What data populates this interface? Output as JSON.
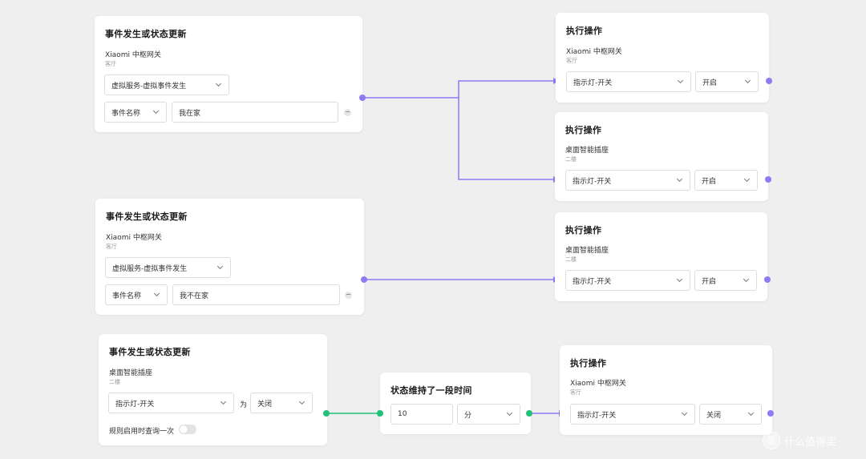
{
  "trigger_1": {
    "title": "事件发生或状态更新",
    "device": "Xiaomi 中枢网关",
    "room": "客厅",
    "event_select": "虚拟服务-虚拟事件发生",
    "param_select": "事件名称",
    "param_value": "我在家",
    "remove_symbol": "−"
  },
  "action_1": {
    "title": "执行操作",
    "device": "Xiaomi 中枢网关",
    "room": "客厅",
    "property_select": "指示灯-开关",
    "value_select": "开启"
  },
  "action_2": {
    "title": "执行操作",
    "device": "桌面智能插座",
    "room": "二楼",
    "property_select": "指示灯-开关",
    "value_select": "开启"
  },
  "trigger_2": {
    "title": "事件发生或状态更新",
    "device": "Xiaomi 中枢网关",
    "room": "客厅",
    "event_select": "虚拟服务-虚拟事件发生",
    "param_select": "事件名称",
    "param_value": "我不在家",
    "remove_symbol": "−"
  },
  "action_3": {
    "title": "执行操作",
    "device": "桌面智能插座",
    "room": "二楼",
    "property_select": "指示灯-开关",
    "value_select": "开启"
  },
  "trigger_3": {
    "title": "事件发生或状态更新",
    "device": "桌面智能插座",
    "room": "二楼",
    "property_select": "指示灯-开关",
    "is_label": "为",
    "value_select": "关闭",
    "query_label": "规则启用时查询一次",
    "query_toggle_on": false
  },
  "condition_1": {
    "title": "状态维持了一段时间",
    "duration_value": "10",
    "unit_select": "分"
  },
  "action_4": {
    "title": "执行操作",
    "device": "Xiaomi 中枢网关",
    "room": "客厅",
    "property_select": "指示灯-开关",
    "value_select": "关闭"
  },
  "watermark": {
    "icon_glyph": "值",
    "text": "什么值得买"
  },
  "colors": {
    "wire": "#8b7bf5",
    "wire_green": "#22c07a",
    "background": "#efefef"
  }
}
